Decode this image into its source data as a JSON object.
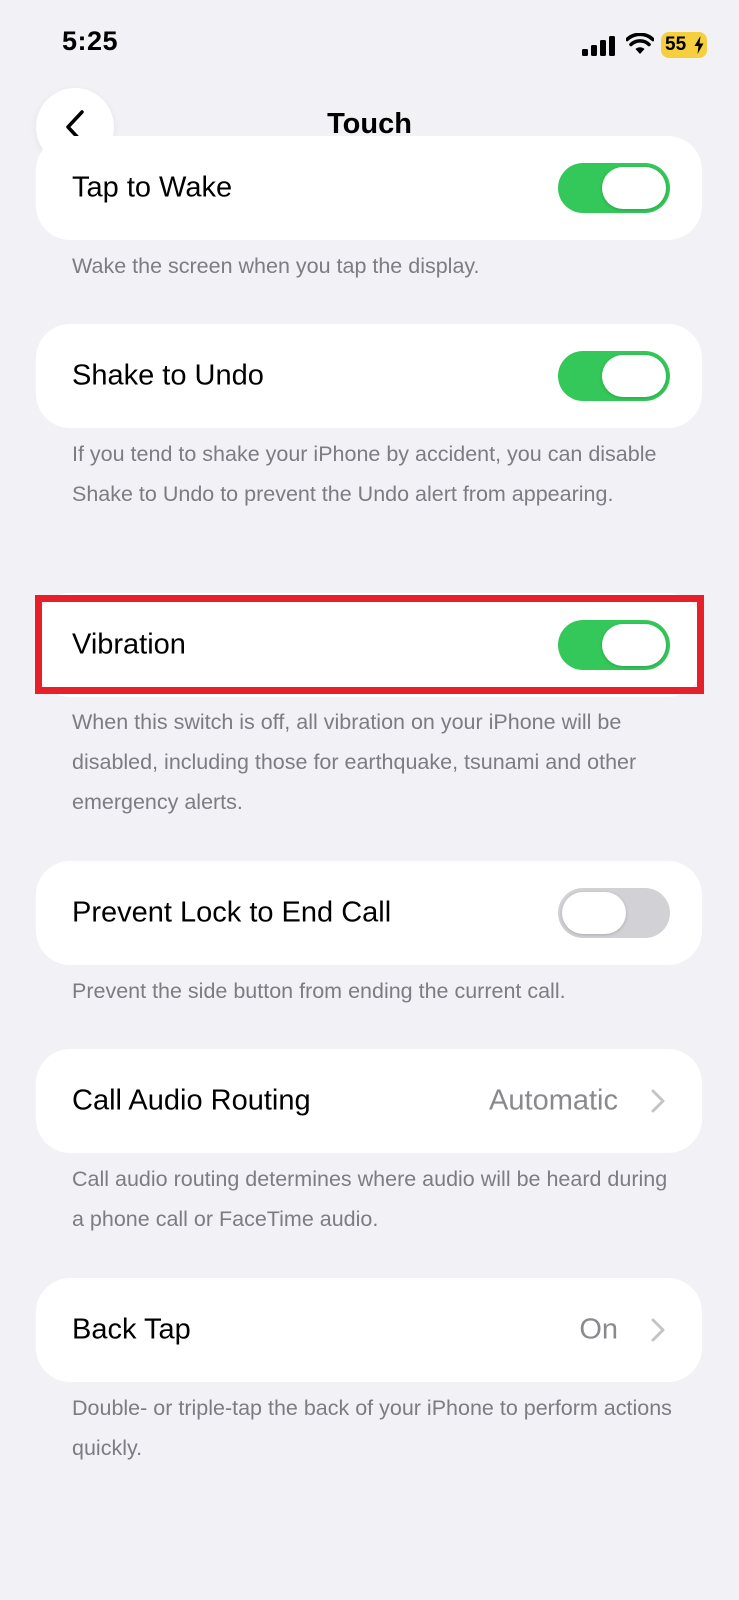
{
  "status_bar": {
    "time": "5:25",
    "battery": "55",
    "icons": [
      "signal-bars-icon",
      "wifi-icon",
      "charging-bolt-icon"
    ]
  },
  "nav": {
    "title": "Touch",
    "back_icon": "chevron-left-icon"
  },
  "rows": [
    {
      "label": "Tap to Wake",
      "control": "toggle",
      "on": true,
      "footer": "Wake the screen when you tap the display."
    },
    {
      "label": "Shake to Undo",
      "control": "toggle",
      "on": true,
      "footer": "If you tend to shake your iPhone by accident, you can disable Shake to Undo to prevent the Undo alert from appearing."
    },
    {
      "label": "Vibration",
      "control": "toggle",
      "on": true,
      "highlighted": true,
      "footer": "When this switch is off, all vibration on your iPhone will be disabled, including those for earthquake, tsunami and other emergency alerts."
    },
    {
      "label": "Prevent Lock to End Call",
      "control": "toggle",
      "on": false,
      "footer": "Prevent the side button from ending the current call."
    },
    {
      "label": "Call Audio Routing",
      "control": "disclosure",
      "value": "Automatic",
      "footer": "Call audio routing determines where audio will be heard during a phone call or FaceTime audio."
    },
    {
      "label": "Back Tap",
      "control": "disclosure",
      "value": "On",
      "footer": "Double- or triple-tap the back of your iPhone to perform actions quickly."
    }
  ],
  "colors": {
    "background": "#f1f1f6",
    "toggle_on": "#34c759",
    "toggle_off": "#d1d1d6",
    "highlight": "#e5202b",
    "battery": "#f5cf3e"
  }
}
